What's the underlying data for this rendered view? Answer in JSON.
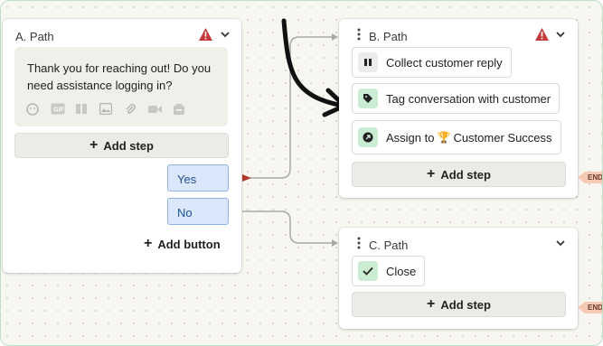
{
  "cards": {
    "a": {
      "title": "A. Path",
      "message": "Thank you for reaching out! Do you need assistance logging in?",
      "toolbar_icons": [
        "emoji-icon",
        "gif-icon",
        "book-icon",
        "image-icon",
        "attachment-icon",
        "video-icon",
        "ticket-icon"
      ],
      "add_step": "Add step",
      "choices": [
        "Yes",
        "No"
      ],
      "add_button": "Add button"
    },
    "b": {
      "title": "B. Path",
      "steps": [
        {
          "label": "Collect customer reply",
          "icon": "pause-icon"
        },
        {
          "label": "Tag conversation with customer",
          "icon": "tag-icon"
        },
        {
          "label_before": "Assign to",
          "emoji": "🏆",
          "label_after": "Customer Success",
          "icon": "assign-arrow-icon"
        }
      ],
      "add_step": "Add step",
      "end": "END"
    },
    "c": {
      "title": "C. Path",
      "steps": [
        {
          "label": "Close",
          "icon": "check-icon"
        }
      ],
      "add_step": "Add step",
      "end": "END"
    }
  },
  "plus_glyph": "+",
  "colors": {
    "warning": "#c43a3a",
    "choice_bg": "#dbe7fb",
    "choice_border": "#90b3e6",
    "end_tag": "#f6c9b5",
    "connector": "#9a9a9a"
  }
}
